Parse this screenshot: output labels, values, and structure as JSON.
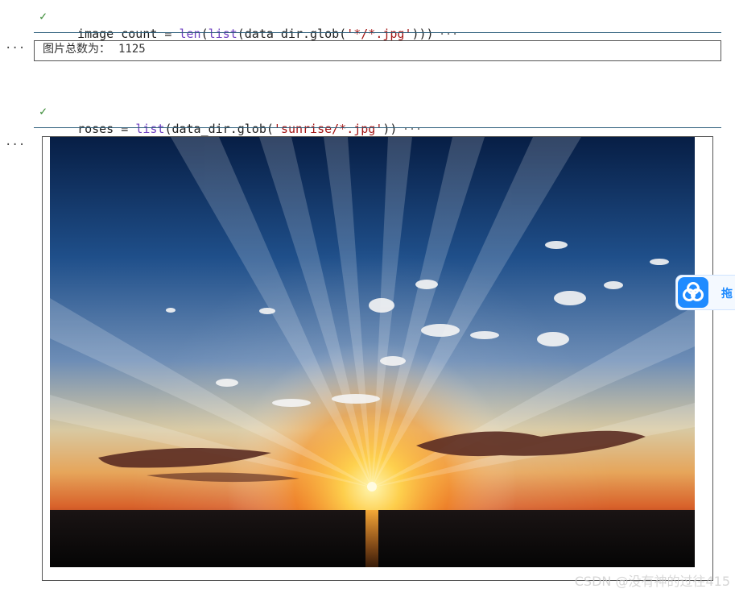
{
  "cells": [
    {
      "code": {
        "var": "image_count",
        "op": " = ",
        "fn1": "len",
        "p1": "(",
        "fn2": "list",
        "p2": "(data_dir.glob(",
        "str": "'*/*.jpg'",
        "p3": ")))",
        "ellipsis": "···"
      },
      "output": {
        "more": "···",
        "label": "图片总数为：",
        "value": "1125"
      }
    },
    {
      "code": {
        "var": "roses",
        "op": " = ",
        "fn1": "list",
        "p1": "(data_dir.glob(",
        "str": "'sunrise/*.jpg'",
        "p3": "))",
        "ellipsis": "···"
      },
      "output": {
        "more": "···",
        "image_alt": "sunrise"
      }
    }
  ],
  "side_widget": {
    "text": "拖"
  },
  "watermark": "CSDN @没有神的过往415",
  "colors": {
    "accent": "#1f8bff",
    "check": "#388a34",
    "rule": "#2b5d7a"
  }
}
